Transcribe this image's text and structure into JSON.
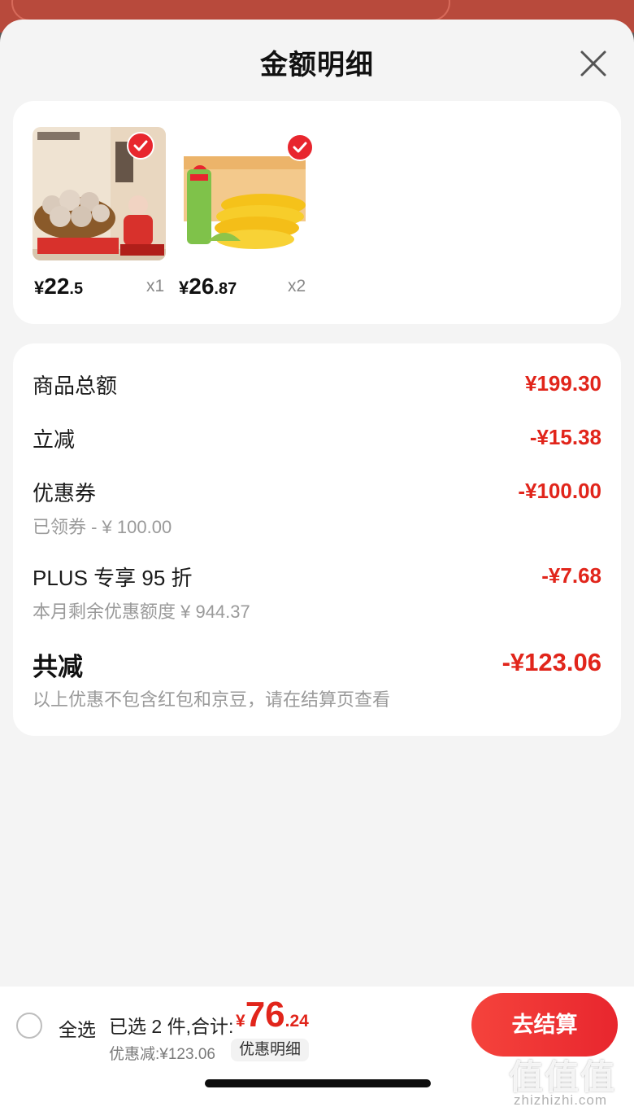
{
  "sheet": {
    "title": "金额明细"
  },
  "products": [
    {
      "image": "beef-ball-product-image",
      "price_yen": "¥",
      "price_int": "22",
      "price_dec": ".5",
      "qty": "x1",
      "selected": true
    },
    {
      "image": "corn-product-image",
      "price_yen": "¥",
      "price_int": "26",
      "price_dec": ".87",
      "qty": "x2",
      "selected": true
    }
  ],
  "detail": {
    "goods_total_label": "商品总额",
    "goods_total_value": "¥199.30",
    "instant_cut_label": "立减",
    "instant_cut_value": "-¥15.38",
    "coupon_label": "优惠券",
    "coupon_value": "-¥100.00",
    "coupon_sub": "已领券 - ¥ 100.00",
    "plus_label": "PLUS 专享 95 折",
    "plus_value": "-¥7.68",
    "plus_sub": "本月剩余优惠额度 ¥ 944.37",
    "total_cut_label": "共减",
    "total_cut_value": "-¥123.06",
    "total_cut_note": "以上优惠不包含红包和京豆，请在结算页查看"
  },
  "bottom_bar": {
    "select_all_label": "全选",
    "selected_text": "已选 2 件,合计:",
    "total_yen": "¥",
    "total_int": "76",
    "total_dec": ".24",
    "discount_text": "优惠减:¥123.06",
    "detail_chip_label": "优惠明细",
    "checkout_label": "去结算"
  },
  "watermark": {
    "glyphs": "值值值",
    "url": "zhizhizhi.com"
  },
  "colors": {
    "accent_red": "#e1251b",
    "button_red": "#e8262e",
    "sheet_bg": "#f4f4f4"
  }
}
